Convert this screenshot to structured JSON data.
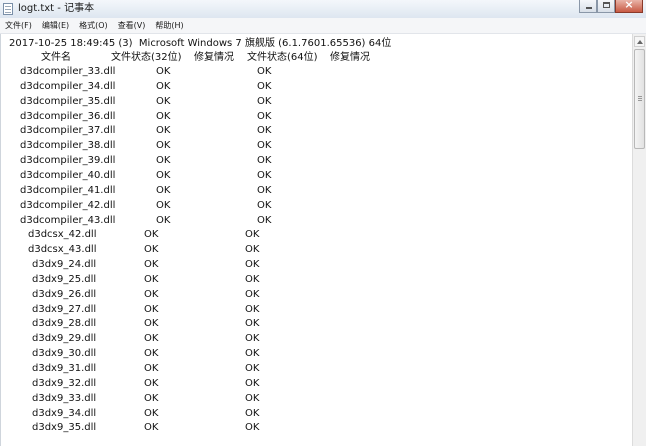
{
  "window": {
    "title": "logt.txt - 记事本"
  },
  "menu": [
    {
      "label": "文件(F)"
    },
    {
      "label": "编辑(E)"
    },
    {
      "label": "格式(O)"
    },
    {
      "label": "查看(V)"
    },
    {
      "label": "帮助(H)"
    }
  ],
  "document": {
    "header": "2017-10-25 18:49:45 (3)  Microsoft Windows 7 旗舰版 (6.1.7601.65536) 64位",
    "columns": {
      "file": "文件名",
      "status32": "文件状态(32位)",
      "repair32": "修复情况",
      "status64": "文件状态(64位)",
      "repair64": "修复情况"
    },
    "rows": [
      {
        "file": "d3dcompiler_33.dll",
        "status32": "OK",
        "status64": "OK"
      },
      {
        "file": "d3dcompiler_34.dll",
        "status32": "OK",
        "status64": "OK"
      },
      {
        "file": "d3dcompiler_35.dll",
        "status32": "OK",
        "status64": "OK"
      },
      {
        "file": "d3dcompiler_36.dll",
        "status32": "OK",
        "status64": "OK"
      },
      {
        "file": "d3dcompiler_37.dll",
        "status32": "OK",
        "status64": "OK"
      },
      {
        "file": "d3dcompiler_38.dll",
        "status32": "OK",
        "status64": "OK"
      },
      {
        "file": "d3dcompiler_39.dll",
        "status32": "OK",
        "status64": "OK"
      },
      {
        "file": "d3dcompiler_40.dll",
        "status32": "OK",
        "status64": "OK"
      },
      {
        "file": "d3dcompiler_41.dll",
        "status32": "OK",
        "status64": "OK"
      },
      {
        "file": "d3dcompiler_42.dll",
        "status32": "OK",
        "status64": "OK"
      },
      {
        "file": "d3dcompiler_43.dll",
        "status32": "OK",
        "status64": "OK"
      },
      {
        "file": "d3dcsx_42.dll",
        "status32": "OK",
        "status64": "OK"
      },
      {
        "file": "d3dcsx_43.dll",
        "status32": "OK",
        "status64": "OK"
      },
      {
        "file": "d3dx9_24.dll",
        "status32": "OK",
        "status64": "OK"
      },
      {
        "file": "d3dx9_25.dll",
        "status32": "OK",
        "status64": "OK"
      },
      {
        "file": "d3dx9_26.dll",
        "status32": "OK",
        "status64": "OK"
      },
      {
        "file": "d3dx9_27.dll",
        "status32": "OK",
        "status64": "OK"
      },
      {
        "file": "d3dx9_28.dll",
        "status32": "OK",
        "status64": "OK"
      },
      {
        "file": "d3dx9_29.dll",
        "status32": "OK",
        "status64": "OK"
      },
      {
        "file": "d3dx9_30.dll",
        "status32": "OK",
        "status64": "OK"
      },
      {
        "file": "d3dx9_31.dll",
        "status32": "OK",
        "status64": "OK"
      },
      {
        "file": "d3dx9_32.dll",
        "status32": "OK",
        "status64": "OK"
      },
      {
        "file": "d3dx9_33.dll",
        "status32": "OK",
        "status64": "OK"
      },
      {
        "file": "d3dx9_34.dll",
        "status32": "OK",
        "status64": "OK"
      },
      {
        "file": "d3dx9_35.dll",
        "status32": "OK",
        "status64": "OK"
      }
    ]
  },
  "icons": {
    "app": "notepad-icon",
    "minimize": "minimize-icon",
    "maximize": "maximize-icon",
    "close": "close-icon",
    "scroll_up": "arrow-up-icon"
  }
}
